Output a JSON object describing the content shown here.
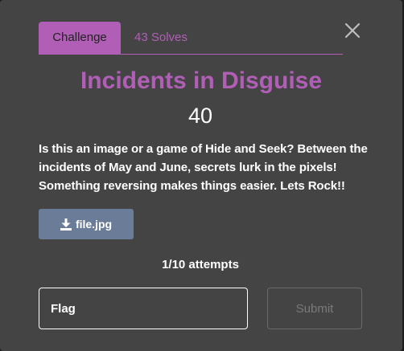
{
  "tabs": {
    "challenge_label": "Challenge",
    "solves_label": "43 Solves"
  },
  "challenge": {
    "title": "Incidents in Disguise",
    "points": "40",
    "description": "Is this an image or a game of Hide and Seek? Between the incidents of May and June, secrets lurk in the pixels! Something reversing makes things easier. Lets Rock!!",
    "file_label": "file.jpg",
    "attempts": "1/10 attempts"
  },
  "form": {
    "flag_placeholder": "Flag",
    "submit_label": "Submit"
  },
  "icons": {
    "close": "close-icon",
    "download": "download-icon"
  },
  "colors": {
    "accent": "#b15fb6",
    "modal_bg": "#444444",
    "download_button": "#6b7c98"
  }
}
